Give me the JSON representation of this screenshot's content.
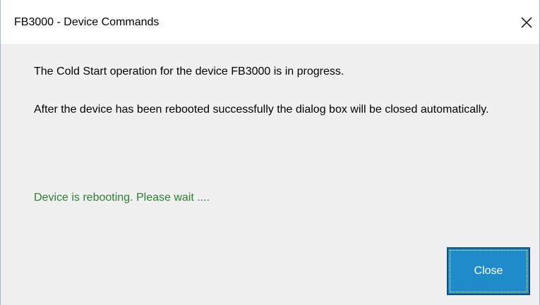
{
  "window": {
    "title": "FB3000 - Device Commands",
    "close_icon": "close-icon"
  },
  "content": {
    "message_line1": "The Cold Start operation for the device FB3000 is in progress.",
    "message_line2": "After the device has been rebooted successfully the dialog box will be closed automatically.",
    "status_text": "Device is rebooting. Please wait ....",
    "status_color": "#2e7d32"
  },
  "buttons": {
    "close_label": "Close",
    "accent_color": "#1f8bcb"
  }
}
